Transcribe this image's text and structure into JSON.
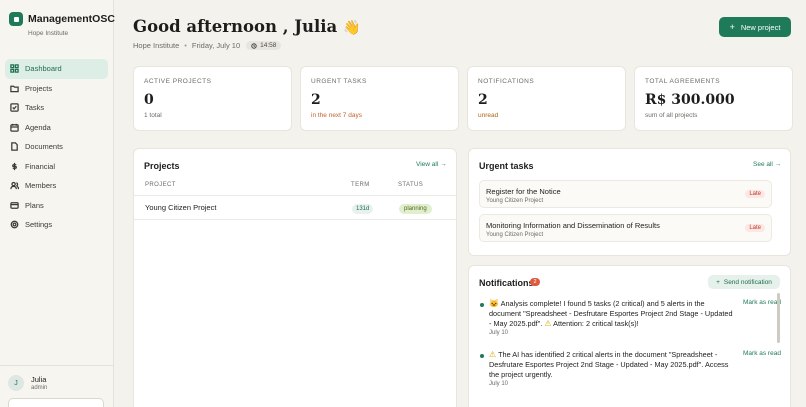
{
  "app": {
    "name": "ManagementOSC",
    "org": "Hope Institute"
  },
  "sidebar": {
    "items": [
      {
        "label": "Dashboard",
        "icon": "grid-icon",
        "active": true
      },
      {
        "label": "Projects",
        "icon": "folder-icon"
      },
      {
        "label": "Tasks",
        "icon": "check-square-icon"
      },
      {
        "label": "Agenda",
        "icon": "calendar-icon"
      },
      {
        "label": "Documents",
        "icon": "file-icon"
      },
      {
        "label": "Financial",
        "icon": "dollar-icon"
      },
      {
        "label": "Members",
        "icon": "users-icon"
      },
      {
        "label": "Plans",
        "icon": "card-icon"
      },
      {
        "label": "Settings",
        "icon": "gear-icon"
      }
    ],
    "user": {
      "initial": "J",
      "name": "Julia",
      "role": "admin"
    }
  },
  "header": {
    "greeting": "Good afternoon , Julia",
    "wave": "👋",
    "org": "Hope Institute",
    "date": "Friday, July 10",
    "time": "14:58",
    "new_project": "New project"
  },
  "stats": [
    {
      "label": "ACTIVE PROJECTS",
      "value": "0",
      "sub": "1 total"
    },
    {
      "label": "URGENT TASKS",
      "value": "2",
      "sub": "in the next 7 days"
    },
    {
      "label": "NOTIFICATIONS",
      "value": "2",
      "sub": "unread"
    },
    {
      "label": "TOTAL AGREEMENTS",
      "value": "R$ 300.000",
      "sub": "sum of all projects"
    }
  ],
  "projects": {
    "title": "Projects",
    "view_all": "View all →",
    "columns": [
      "PROJECT",
      "TERM",
      "STATUS"
    ],
    "rows": [
      {
        "name": "Young Citizen Project",
        "term": "131d",
        "status": "planning"
      }
    ]
  },
  "urgent": {
    "title": "Urgent tasks",
    "see_all": "See all →",
    "tasks": [
      {
        "title": "Register for the Notice",
        "project": "Young Citizen Project",
        "badge": "Late"
      },
      {
        "title": "Monitoring Information and Dissemination of Results",
        "project": "Young Citizen Project",
        "badge": "Late"
      }
    ]
  },
  "notifications": {
    "title": "Notifications",
    "count": "2",
    "send": "Send notification",
    "mark_read": "Mark as read",
    "items": [
      {
        "icon1": "🐱",
        "text_a": " Analysis complete! I found 5 tasks (2 critical) and 5 alerts in the document \"Spreadsheet - Desfrutare Esportes Project 2nd Stage - Updated - May 2025.pdf\". ",
        "icon2": "⚠",
        "text_b": " Attention: 2 critical task(s)!",
        "date": "July 10"
      },
      {
        "icon1": "⚠",
        "text_a": " The AI has identified 2 critical alerts in the document \"Spreadsheet - Desfrutare Esportes Project 2nd Stage - Updated - May 2025.pdf\". Access the project urgently.",
        "icon2": "",
        "text_b": "",
        "date": "July 10"
      }
    ]
  },
  "colors": {
    "accent": "#1f7a5a",
    "warning": "#c4622d",
    "danger": "#c0392b",
    "background": "#f4f2ed"
  }
}
